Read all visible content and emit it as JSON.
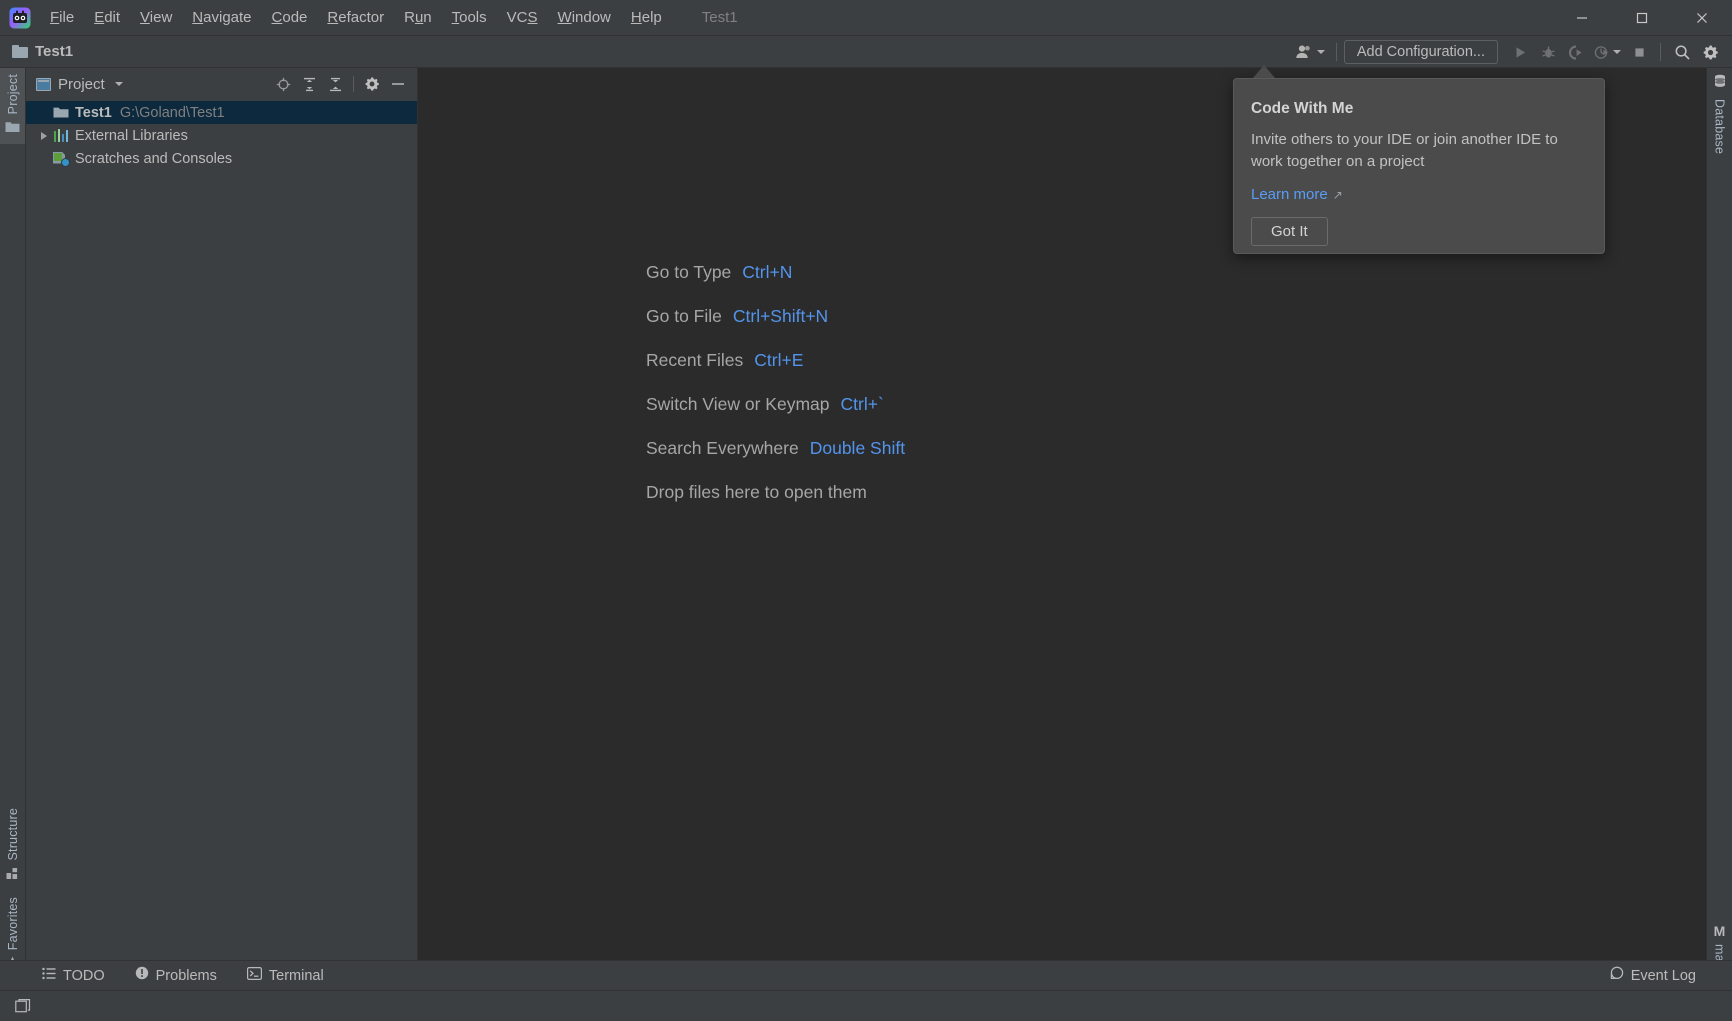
{
  "window": {
    "project_name": "Test1",
    "controls": {
      "minimize": "—",
      "maximize": "☐",
      "close": "✕"
    }
  },
  "menu": {
    "items": [
      {
        "label": "File",
        "mnemonic": "F"
      },
      {
        "label": "Edit",
        "mnemonic": "E"
      },
      {
        "label": "View",
        "mnemonic": "V"
      },
      {
        "label": "Navigate",
        "mnemonic": "N"
      },
      {
        "label": "Code",
        "mnemonic": "C"
      },
      {
        "label": "Refactor",
        "mnemonic": "R"
      },
      {
        "label": "Run",
        "mnemonic": "u"
      },
      {
        "label": "Tools",
        "mnemonic": "T"
      },
      {
        "label": "VCS",
        "mnemonic": "S"
      },
      {
        "label": "Window",
        "mnemonic": "W"
      },
      {
        "label": "Help",
        "mnemonic": "H"
      }
    ]
  },
  "navbar": {
    "breadcrumb": "Test1",
    "add_configuration_label": "Add Configuration...",
    "icons": {
      "code_with_me": "people-icon",
      "run": "run-icon",
      "debug": "debug-icon",
      "run_coverage": "run-with-coverage-icon",
      "profiler": "profiler-icon",
      "stop": "stop-icon",
      "search": "search-icon",
      "settings": "gear-icon"
    }
  },
  "left_stripe": {
    "top": [
      {
        "label": "Project",
        "icon": "project-folder-icon",
        "active": true
      }
    ],
    "bottom": [
      {
        "label": "Structure",
        "icon": "structure-icon"
      },
      {
        "label": "Favorites",
        "icon": "star-icon"
      }
    ]
  },
  "right_stripe": {
    "top": [
      {
        "label": "Database",
        "icon": "database-icon"
      }
    ],
    "bottom": [
      {
        "label": "make",
        "icon": "make-icon"
      }
    ]
  },
  "project_panel": {
    "title": "Project",
    "toolbar": [
      {
        "name": "select-opened-file-icon"
      },
      {
        "name": "expand-all-icon"
      },
      {
        "name": "collapse-all-icon"
      },
      {
        "name": "gear-icon"
      },
      {
        "name": "hide-icon"
      }
    ],
    "tree": [
      {
        "label": "Test1",
        "sublabel": "G:\\Goland\\Test1",
        "icon": "folder-icon",
        "selected": true,
        "bold": true,
        "indent": 0,
        "arrow": false
      },
      {
        "label": "External Libraries",
        "sublabel": "",
        "icon": "library-icon",
        "selected": false,
        "bold": false,
        "indent": 0,
        "arrow": true
      },
      {
        "label": "Scratches and Consoles",
        "sublabel": "",
        "icon": "scratches-icon",
        "selected": false,
        "bold": false,
        "indent": 0,
        "arrow": false
      }
    ]
  },
  "editor": {
    "hints": [
      {
        "action": "Go to Type",
        "key": "Ctrl+N"
      },
      {
        "action": "Go to File",
        "key": "Ctrl+Shift+N"
      },
      {
        "action": "Recent Files",
        "key": "Ctrl+E"
      },
      {
        "action": "Switch View or Keymap",
        "key": "Ctrl+`"
      },
      {
        "action": "Search Everywhere",
        "key": "Double Shift"
      },
      {
        "action": "Drop files here to open them",
        "key": ""
      }
    ]
  },
  "code_with_me_popup": {
    "title": "Code With Me",
    "body": "Invite others to your IDE or join another IDE to work together on a project",
    "learn_more": "Learn more",
    "external_arrow": "↗",
    "got_it": "Got It"
  },
  "status_tools": {
    "left": [
      {
        "label": "TODO",
        "icon": "todo-icon"
      },
      {
        "label": "Problems",
        "icon": "problems-icon"
      },
      {
        "label": "Terminal",
        "icon": "terminal-icon"
      }
    ],
    "right": [
      {
        "label": "Event Log",
        "icon": "event-log-icon"
      }
    ]
  },
  "colors": {
    "accent_blue": "#5394ec",
    "link_blue": "#589df6",
    "selection": "#0d293e",
    "panel_bg": "#3c3f41",
    "editor_bg": "#2b2b2b",
    "popup_bg": "#4b4b4b",
    "text": "#bbbbbb",
    "muted_text": "#808080"
  }
}
